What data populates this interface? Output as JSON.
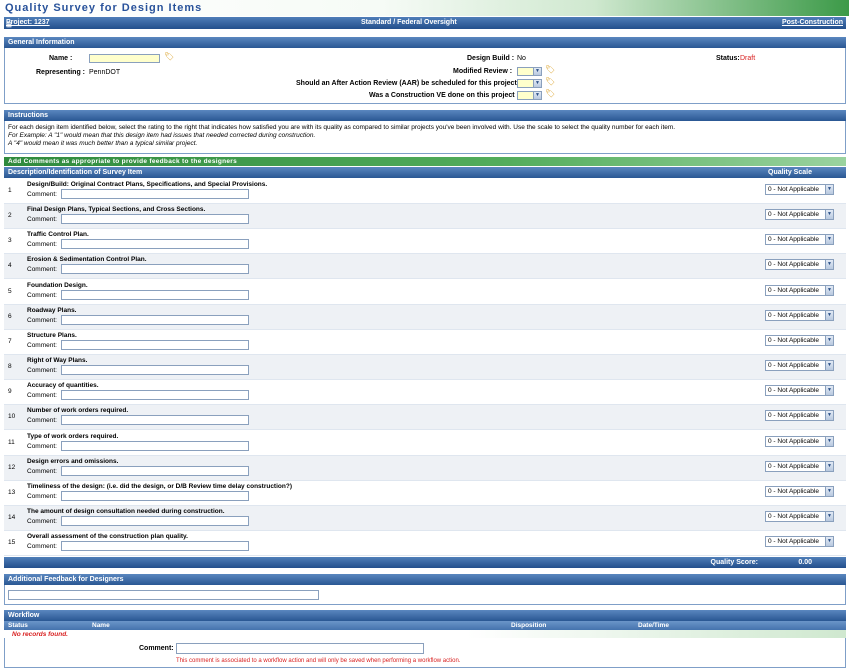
{
  "title": "Quality Survey for Design Items",
  "project_bar": {
    "expand_icon": "plus-box-icon",
    "project": "Project: 1237",
    "center": "Standard  /  Federal Oversight",
    "right_link": "Post-Construction"
  },
  "general": {
    "header": "General Information",
    "name_label": "Name :",
    "representing_label": "Representing :",
    "representing_value": "PennDOT",
    "design_build_label": "Design Build :",
    "design_build_value": "No",
    "status_label": "Status:",
    "status_value": "Draft",
    "status_color": "#d81f1f",
    "modified_review_label": "Modified Review :",
    "aar_label": "Should an After Action Review (AAR) be scheduled for this project :",
    "ve_label": "Was a Construction VE done on this project :",
    "field_bg_color": "#ffffcc"
  },
  "instructions": {
    "header": "Instructions",
    "line1": "For each design item identified below, select the rating to the right that indicates how satisfied you are with its quality as compared to similar projects you've been involved with. Use the scale to select the quality number for each item.",
    "line2": "For Example: A \"1\" would mean that this design item had issues that needed corrected during construction.",
    "line3": "A \"4\" would mean it was much better than a typical similar project."
  },
  "comments_banner": "Add Comments as appropriate to provide feedback to the designers",
  "survey": {
    "col_description": "Description/Identification of Survey Item",
    "col_quality": "Quality Scale",
    "comment_label": "Comment:",
    "items": [
      {
        "num": "1",
        "label": "Design/Build: Original Contract Plans, Specifications, and Special Provisions.",
        "quality": "0 - Not Applicable"
      },
      {
        "num": "2",
        "label": "Final Design Plans, Typical Sections, and Cross Sections.",
        "quality": "0 - Not Applicable"
      },
      {
        "num": "3",
        "label": "Traffic Control Plan.",
        "quality": "0 - Not Applicable"
      },
      {
        "num": "4",
        "label": "Erosion & Sedimentation Control Plan.",
        "quality": "0 - Not Applicable"
      },
      {
        "num": "5",
        "label": "Foundation Design.",
        "quality": "0 - Not Applicable"
      },
      {
        "num": "6",
        "label": "Roadway Plans.",
        "quality": "0 - Not Applicable"
      },
      {
        "num": "7",
        "label": "Structure Plans.",
        "quality": "0 - Not Applicable"
      },
      {
        "num": "8",
        "label": "Right of Way Plans.",
        "quality": "0 - Not Applicable"
      },
      {
        "num": "9",
        "label": "Accuracy of quantities.",
        "quality": "0 - Not Applicable"
      },
      {
        "num": "10",
        "label": "Number of work orders required.",
        "quality": "0 - Not Applicable"
      },
      {
        "num": "11",
        "label": "Type of work orders required.",
        "quality": "0 - Not Applicable"
      },
      {
        "num": "12",
        "label": "Design errors and omissions.",
        "quality": "0 - Not Applicable"
      },
      {
        "num": "13",
        "label": "Timeliness of the design: (i.e. did the design, or D/B Review time delay construction?)",
        "quality": "0 - Not Applicable"
      },
      {
        "num": "14",
        "label": "The amount of design consultation needed during construction.",
        "quality": "0 - Not Applicable"
      },
      {
        "num": "15",
        "label": "Overall assessment of the construction plan quality.",
        "quality": "0 - Not Applicable"
      }
    ],
    "score_label": "Quality Score:",
    "score_value": "0.00"
  },
  "feedback": {
    "header": "Additional Feedback for Designers"
  },
  "workflow": {
    "header": "Workflow",
    "columns": [
      "Status",
      "Name",
      "Disposition",
      "Date/Time"
    ],
    "no_records": "No records found.",
    "comment_label": "Comment:",
    "note": "This comment is associated to a workflow action and will only be saved when performing a workflow action."
  },
  "colors": {
    "header_blue": "#2a5793",
    "title_blue": "#28529a",
    "banner_green": "#3c9a48",
    "alert_red": "#d81f1f"
  }
}
